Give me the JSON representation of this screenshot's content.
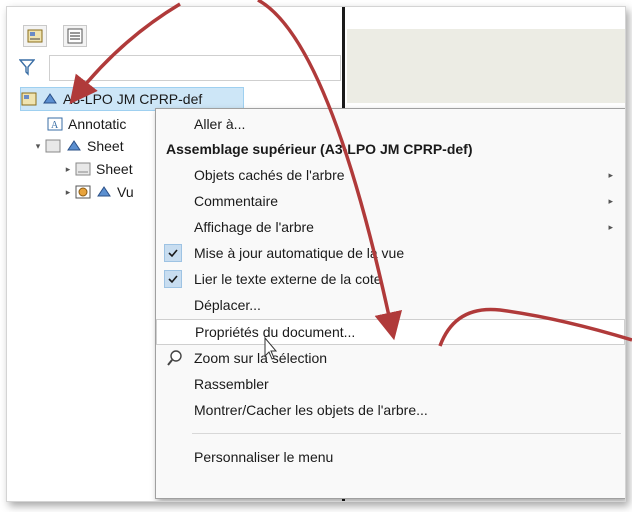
{
  "tree": {
    "root_label": "A3-LPO JM CPRP-def",
    "annotation_label": "Annotatic",
    "sheet_label": "Sheet",
    "sheet_child_label": "Sheet",
    "view_label": "Vu"
  },
  "menu": {
    "items": [
      {
        "label": "Aller à..."
      },
      {
        "label": "Assemblage supérieur (A3-LPO JM CPRP-def)"
      },
      {
        "label": "Objets cachés de l'arbre"
      },
      {
        "label": "Commentaire"
      },
      {
        "label": "Affichage de l'arbre"
      },
      {
        "label": "Mise à jour automatique de la vue"
      },
      {
        "label": "Lier le texte externe de la cote"
      },
      {
        "label": "Déplacer..."
      },
      {
        "label": "Propriétés du document..."
      },
      {
        "label": "Zoom sur la sélection"
      },
      {
        "label": "Rassembler"
      },
      {
        "label": "Montrer/Cacher les objets de l'arbre..."
      },
      {
        "label": "Personnaliser le menu"
      }
    ]
  },
  "colors": {
    "arrow": "#b03a3a",
    "selection_bg": "#cde6f7",
    "check_bg": "#c8ddf0"
  }
}
